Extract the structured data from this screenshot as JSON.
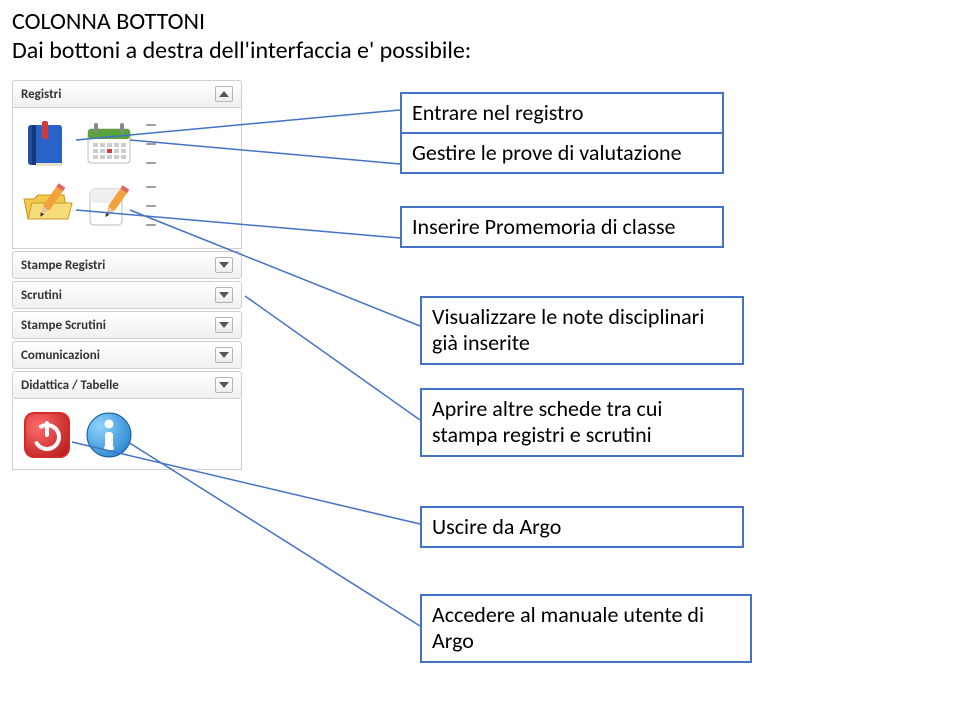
{
  "heading": {
    "line1": "COLONNA BOTTONI",
    "line2": "Dai bottoni a destra dell'interfaccia e' possibile:"
  },
  "sidebar": {
    "registri_label": "Registri",
    "items": {
      "stampe_registri": "Stampe Registri",
      "scrutini": "Scrutini",
      "stampe_scrutini": "Stampe Scrutini",
      "comunicazioni": "Comunicazioni",
      "didattica": "Didattica / Tabelle"
    }
  },
  "callouts": {
    "c1": "Entrare nel registro",
    "c2": "Gestire le prove di valutazione",
    "c3": "Inserire Promemoria di classe",
    "c4": "Visualizzare le note disciplinari già inserite",
    "c5": "Aprire altre schede tra cui stampa registri e scrutini",
    "c6": "Uscire da Argo",
    "c7": "Accedere al manuale utente di Argo"
  }
}
